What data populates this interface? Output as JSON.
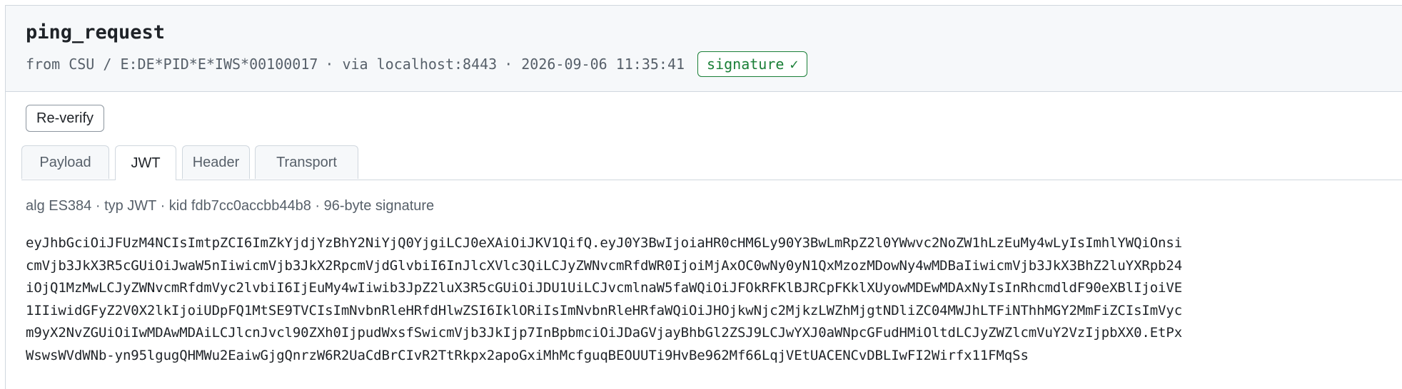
{
  "message": {
    "title": "ping_request",
    "from_label": "from CSU / E:DE*PID*E*IWS*00100017",
    "via_label": "via localhost:8443",
    "timestamp": "2026-09-06 11:35:41",
    "separator": "·",
    "signature_badge": "signature",
    "signature_check": "✓",
    "signature_color": "#1a7f37"
  },
  "actions": {
    "reverify_label": "Re-verify"
  },
  "tabs": [
    {
      "label": "Payload",
      "active": false
    },
    {
      "label": "JWT",
      "active": true
    },
    {
      "label": "Header",
      "active": false
    },
    {
      "label": "Transport",
      "active": false
    }
  ],
  "jwt": {
    "summary": "alg ES384 · typ JWT · kid fdb7cc0accbb44b8 · 96-byte signature",
    "token_lines": [
      "eyJhbGciOiJFUzM4NCIsImtpZCI6ImZkYjdjYzBhY2NiYjQ0YjgiLCJ0eXAiOiJKV1QifQ.eyJ0Y3BwIjoiaHR0cHM6Ly90Y3BwLmRpZ2l0YWwvc2NoZW1hLzEuMy4wLyIsImhlYWQiOnsi",
      "cmVjb3JkX3R5cGUiOiJwaW5nIiwicmVjb3JkX2RpcmVjdGlvbiI6InJlcXVlc3QiLCJyZWNvcmRfdWR0IjoiMjAxOC0wNy0yN1QxMzozMDowNy4wMDBaIiwicmVjb3JkX3BhZ2luYXRpb24",
      "iOjQ1MzMwLCJyZWNvcmRfdmVyc2lvbiI6IjEuMy4wIiwib3JpZ2luX3R5cGUiOiJDU1UiLCJvcmlnaW5faWQiOiJFOkRFKlBJRCpFKklXUyowMDEwMDAxNyIsInRhcmdldF90eXBlIjoiVE",
      "1IIiwidGFyZ2V0X2lkIjoiUDpFQ1MtSE9TVCIsImNvbnRleHRfdHlwZSI6IklORiIsImNvbnRleHRfaWQiOiJHOjkwNjc2MjkzLWZhMjgtNDliZC04MWJhLTFiNThhMGY2MmFiZCIsImVyc",
      "m9yX2NvZGUiOiIwMDAwMDAiLCJlcnJvcl90ZXh0IjpudWxsfSwicmVjb3JkIjp7InBpbmciOiJDaGVjayBhbGl2ZSJ9LCJwYXJ0aWNpcGFudHMiOltdLCJyZWZlcmVuY2VzIjpbXX0.EtPx",
      "WswsWVdWNb-yn95lgugQHMWu2EaiwGjgQnrzW6R2UaCdBrCIvR2TtRkpx2apoGxiMhMcfguqBEOUUTi9HvBe962Mf66LqjVEtUACENCvDBLIwFI2Wirfx11FMqSs"
    ]
  }
}
